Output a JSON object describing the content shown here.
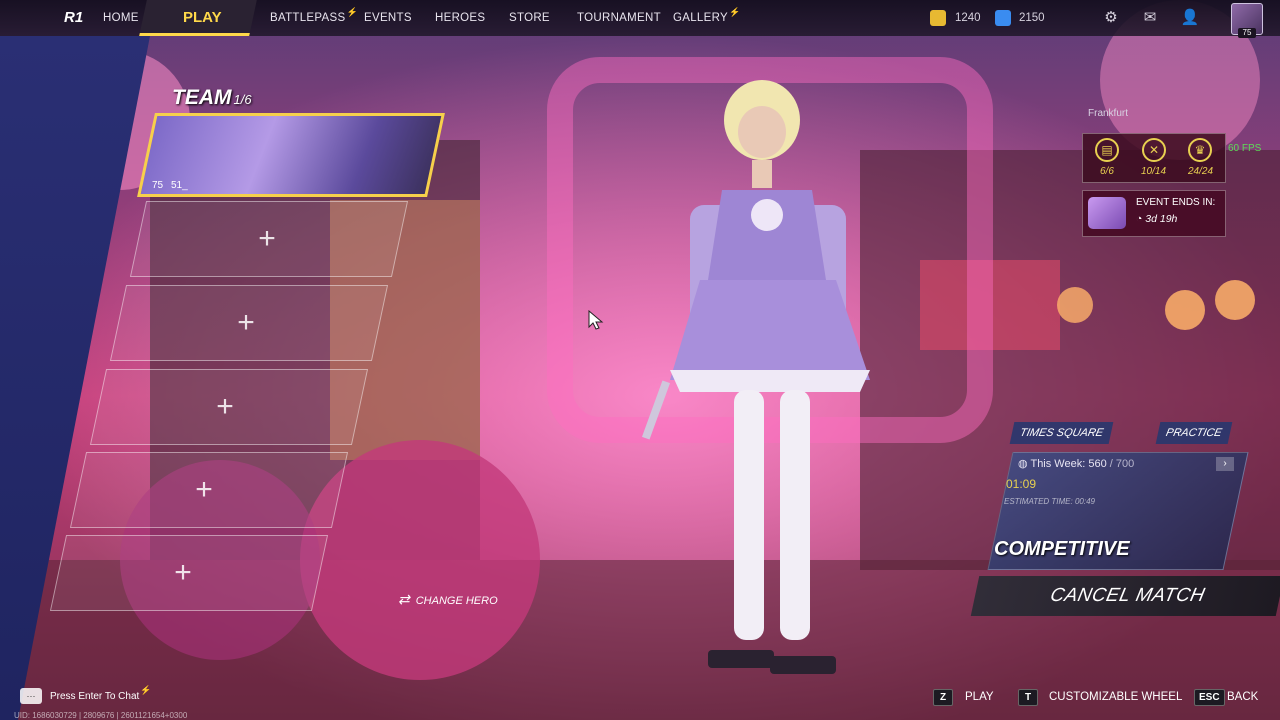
{
  "nav": {
    "logo_text": "R1",
    "home": "HOME",
    "play": "PLAY",
    "battlepass": "BATTLEPASS",
    "events": "EVENTS",
    "heroes": "HEROES",
    "store": "STORE",
    "tournament": "TOURNAMENT",
    "gallery": "GALLERY",
    "currency_gold": "1240",
    "currency_blue": "2150",
    "player_level": "75"
  },
  "team": {
    "title": "TEAM",
    "count": "1/6",
    "member": {
      "level": "75",
      "name": "51_"
    },
    "empty_slot_symbol": "+"
  },
  "change_hero": "CHANGE HERO",
  "server": "Frankfurt",
  "stats": [
    {
      "icon": "scroll-icon",
      "value": "6/6"
    },
    {
      "icon": "crossed-swords-icon",
      "value": "10/14"
    },
    {
      "icon": "trophy-icon",
      "value": "24/24"
    }
  ],
  "fps": "60 FPS",
  "event": {
    "title": "EVENT ENDS IN:",
    "time": "3d 19h"
  },
  "modes": {
    "map": "TIMES SQUARE",
    "practice": "PRACTICE"
  },
  "queue": {
    "week_label": "This Week:",
    "week_value": "560",
    "week_max": "/ 700",
    "timer": "01:09",
    "estimated": "ESTIMATED TIME: 00:49",
    "mode": "COMPETITIVE",
    "cancel": "CANCEL MATCH"
  },
  "bottom": {
    "chat_hint": "Press Enter To Chat",
    "uid": "UID: 1686030729 | 2809676 | 2601121654+0300",
    "keys": [
      {
        "key": "Z",
        "label": "PLAY"
      },
      {
        "key": "T",
        "label": "CUSTOMIZABLE WHEEL"
      },
      {
        "key": "ESC",
        "label": "BACK"
      }
    ]
  },
  "colors": {
    "accent": "#ffd94a",
    "alert": "#ff4646",
    "fps": "#5cdc56",
    "stat": "#e8d050"
  }
}
